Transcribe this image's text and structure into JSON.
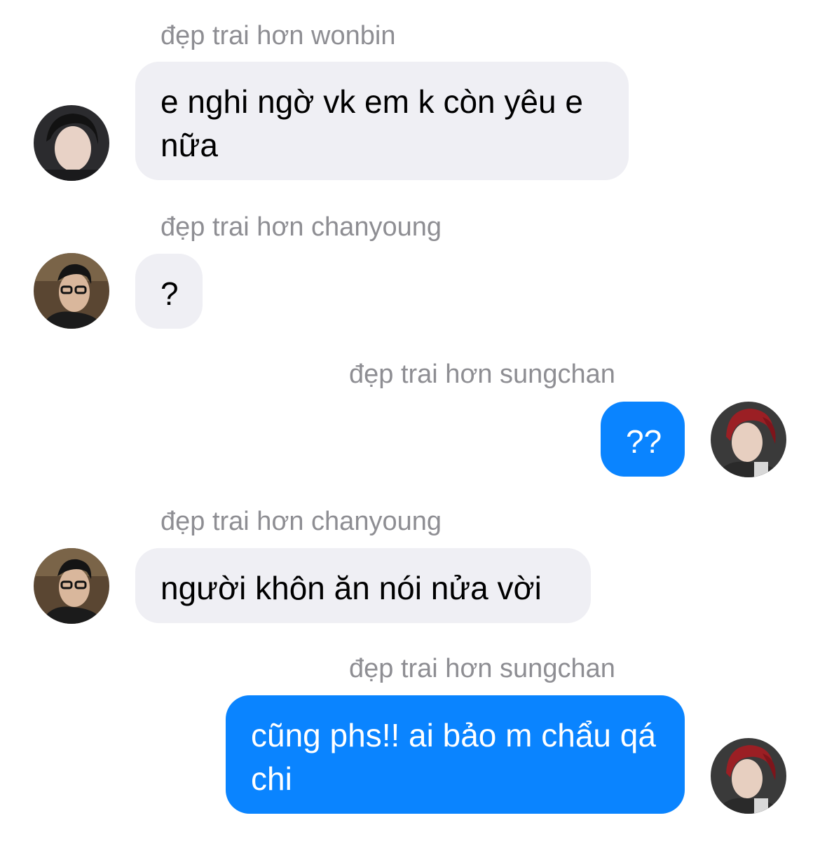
{
  "messages": [
    {
      "sender": "đẹp trai hơn wonbin",
      "text": "e nghi ngờ vk em k còn yêu e nữa",
      "direction": "incoming",
      "avatar": "avatar-wonbin"
    },
    {
      "sender": "đẹp trai hơn chanyoung",
      "text": "?",
      "direction": "incoming",
      "avatar": "avatar-chanyoung"
    },
    {
      "sender": "đẹp trai hơn sungchan",
      "text": "??",
      "direction": "outgoing",
      "avatar": "avatar-sungchan"
    },
    {
      "sender": "đẹp trai hơn chanyoung",
      "text": "người khôn ăn nói nửa vời",
      "direction": "incoming",
      "avatar": "avatar-chanyoung"
    },
    {
      "sender": "đẹp trai hơn sungchan",
      "text": "cũng phs!! ai bảo m chẩu qá chi",
      "direction": "outgoing",
      "avatar": "avatar-sungchan"
    }
  ],
  "colors": {
    "incoming_bubble": "#efeff4",
    "outgoing_bubble": "#0a84ff",
    "sender_label": "#8e8e93"
  }
}
